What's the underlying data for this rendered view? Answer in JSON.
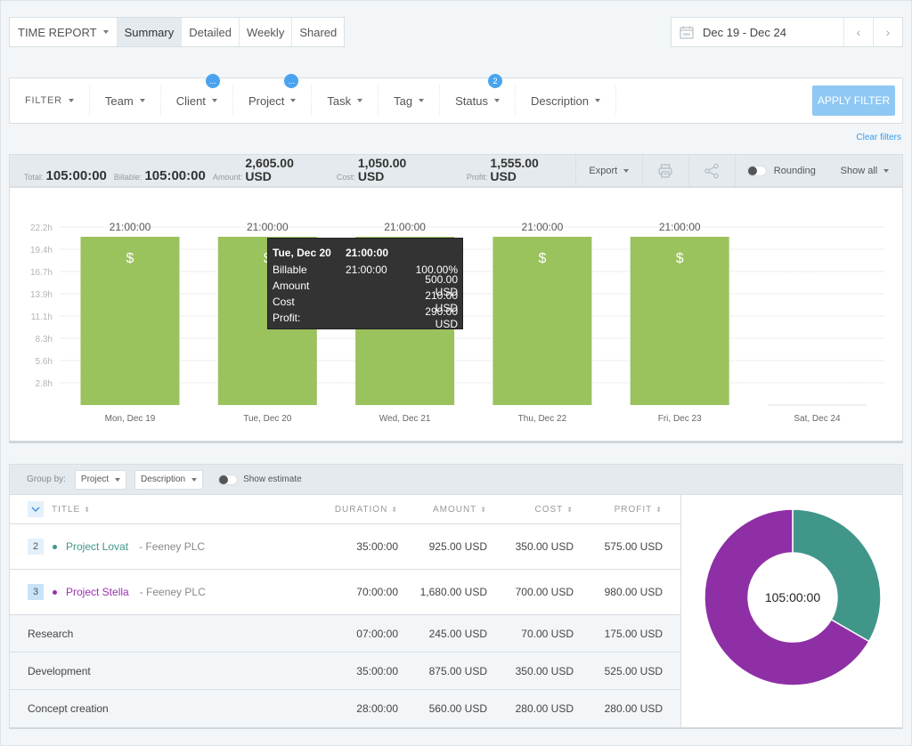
{
  "header": {
    "report_dropdown": "TIME REPORT",
    "tabs": [
      {
        "label": "Summary",
        "active": true
      },
      {
        "label": "Detailed",
        "active": false
      },
      {
        "label": "Weekly",
        "active": false
      },
      {
        "label": "Shared",
        "active": false
      }
    ],
    "date_range": "Dec 19 - Dec 24",
    "prev_icon": "‹",
    "next_icon": "›"
  },
  "filters": {
    "label": "FILTER",
    "items": [
      {
        "label": "Team",
        "badge": null
      },
      {
        "label": "Client",
        "badge": "..."
      },
      {
        "label": "Project",
        "badge": "..."
      },
      {
        "label": "Task",
        "badge": null
      },
      {
        "label": "Tag",
        "badge": null
      },
      {
        "label": "Status",
        "badge": "2"
      },
      {
        "label": "Description",
        "badge": null
      }
    ],
    "apply_label": "APPLY FILTER",
    "clear_label": "Clear filters"
  },
  "summary": {
    "total_label": "Total:",
    "total_value": "105:00:00",
    "billable_label": "Billable:",
    "billable_value": "105:00:00",
    "amount_label": "Amount:",
    "amount_value": "2,605.00",
    "amount_currency": "USD",
    "cost_label": "Cost:",
    "cost_value": "1,050.00",
    "cost_currency": "USD",
    "profit_label": "Profit:",
    "profit_value": "1,555.00",
    "profit_currency": "USD",
    "export_label": "Export",
    "rounding_label": "Rounding",
    "show_all_label": "Show all"
  },
  "chart_data": [
    {
      "type": "bar",
      "title": "",
      "xlabel": "",
      "ylabel": "",
      "categories": [
        "Mon, Dec 19",
        "Tue, Dec 20",
        "Wed, Dec 21",
        "Thu, Dec 22",
        "Fri, Dec 23",
        "Sat, Dec 24"
      ],
      "values": [
        21,
        21,
        21,
        21,
        21,
        0
      ],
      "value_labels": [
        "21:00:00",
        "21:00:00",
        "21:00:00",
        "21:00:00",
        "21:00:00",
        ""
      ],
      "billable": [
        true,
        true,
        true,
        true,
        true,
        false
      ],
      "bar_icon": "$",
      "y_ticks": [
        "2.8h",
        "5.6h",
        "8.3h",
        "11.1h",
        "13.9h",
        "16.7h",
        "19.4h",
        "22.2h"
      ],
      "y_tick_values": [
        2.78,
        5.56,
        8.33,
        11.11,
        13.89,
        16.67,
        19.44,
        22.22
      ],
      "ylim": [
        0,
        22.22
      ],
      "grid": true,
      "bar_color": "#9ac25d",
      "tooltip": {
        "date": "Tue, Dec 20",
        "total": "21:00:00",
        "rows": [
          {
            "label": "Billable",
            "mid": "21:00:00",
            "value": "100.00%"
          },
          {
            "label": "Amount",
            "mid": "",
            "value": "500.00 USD"
          },
          {
            "label": "Cost",
            "mid": "",
            "value": "210.00 USD"
          },
          {
            "label": "Profit:",
            "mid": "",
            "value": "290.00 USD"
          }
        ]
      }
    },
    {
      "type": "pie",
      "center_label": "105:00:00",
      "slices": [
        {
          "name": "Project Lovat",
          "value": 35,
          "color": "#41968a"
        },
        {
          "name": "Project Stella",
          "value": 70,
          "color": "#8e2fa6"
        }
      ]
    }
  ],
  "table": {
    "group_by_label": "Group by:",
    "group_by_1": "Project",
    "group_by_2": "Description",
    "show_estimate_label": "Show estimate",
    "columns": [
      "TITLE",
      "DURATION",
      "AMOUNT",
      "COST",
      "PROFIT"
    ],
    "projects": [
      {
        "count": "2",
        "name": "Project Lovat",
        "client": "- Feeney PLC",
        "color": "#41968a",
        "count_bg": "#e4f1fb",
        "duration": "35:00:00",
        "amount": "925.00 USD",
        "cost": "350.00 USD",
        "profit": "575.00 USD"
      },
      {
        "count": "3",
        "name": "Project Stella",
        "client": "- Feeney PLC",
        "color": "#9b2fb0",
        "count_bg": "#c8e4f8",
        "duration": "70:00:00",
        "amount": "1,680.00 USD",
        "cost": "700.00 USD",
        "profit": "980.00 USD"
      }
    ],
    "descriptions": [
      {
        "title": "Research",
        "duration": "07:00:00",
        "amount": "245.00 USD",
        "cost": "70.00 USD",
        "profit": "175.00 USD"
      },
      {
        "title": "Development",
        "duration": "35:00:00",
        "amount": "875.00 USD",
        "cost": "350.00 USD",
        "profit": "525.00 USD"
      },
      {
        "title": "Concept creation",
        "duration": "28:00:00",
        "amount": "560.00 USD",
        "cost": "280.00 USD",
        "profit": "280.00 USD"
      }
    ]
  }
}
